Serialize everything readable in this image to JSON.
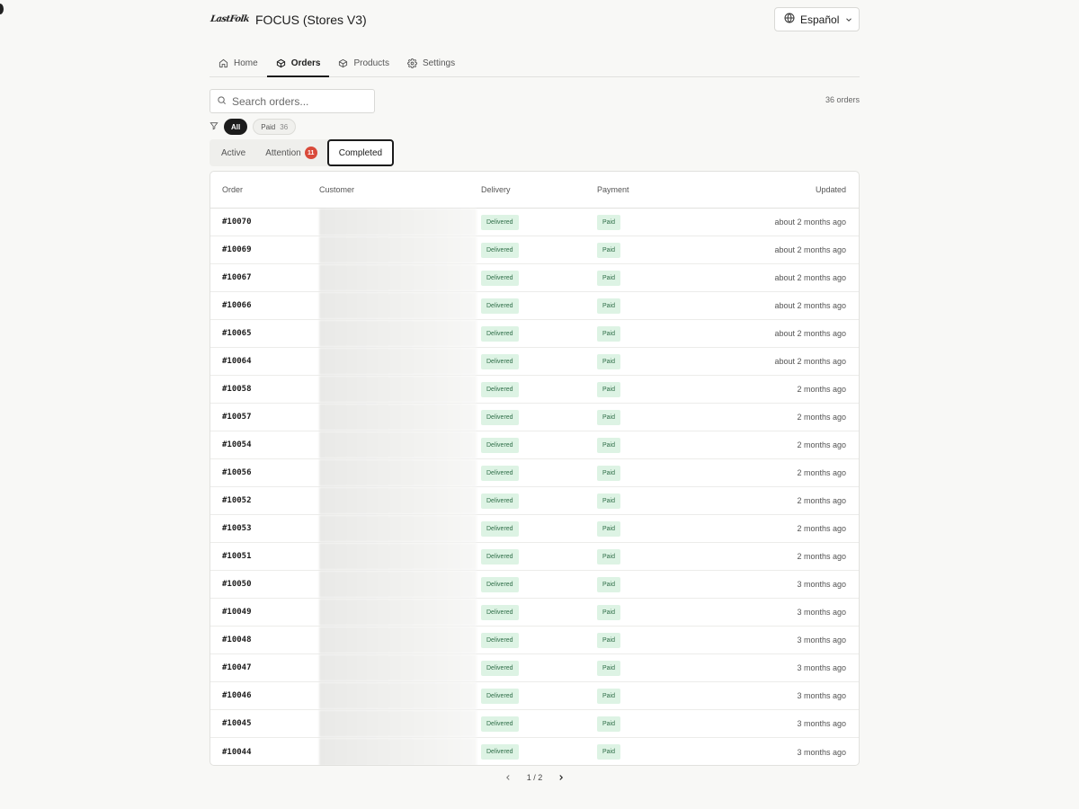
{
  "header": {
    "logo_text": "LastFolk",
    "app_title": "FOCUS (Stores V3)",
    "language": "Español"
  },
  "nav": {
    "tabs": [
      {
        "label": "Home",
        "icon": "home-icon",
        "active": false
      },
      {
        "label": "Orders",
        "icon": "box-icon",
        "active": true
      },
      {
        "label": "Products",
        "icon": "package-icon",
        "active": false
      },
      {
        "label": "Settings",
        "icon": "gear-icon",
        "active": false
      }
    ]
  },
  "search": {
    "placeholder": "Search orders...",
    "value": ""
  },
  "order_count": "36 orders",
  "filters": {
    "all_label": "All",
    "paid_label": "Paid",
    "paid_count": "36"
  },
  "status_tabs": {
    "active": "Active",
    "attention": "Attention",
    "attention_count": "11",
    "completed": "Completed"
  },
  "table": {
    "headers": {
      "order": "Order",
      "customer": "Customer",
      "delivery": "Delivery",
      "payment": "Payment",
      "updated": "Updated"
    },
    "rows": [
      {
        "order": "#10070",
        "delivery": "Delivered",
        "payment": "Paid",
        "updated": "about 2 months ago"
      },
      {
        "order": "#10069",
        "delivery": "Delivered",
        "payment": "Paid",
        "updated": "about 2 months ago"
      },
      {
        "order": "#10067",
        "delivery": "Delivered",
        "payment": "Paid",
        "updated": "about 2 months ago"
      },
      {
        "order": "#10066",
        "delivery": "Delivered",
        "payment": "Paid",
        "updated": "about 2 months ago"
      },
      {
        "order": "#10065",
        "delivery": "Delivered",
        "payment": "Paid",
        "updated": "about 2 months ago"
      },
      {
        "order": "#10064",
        "delivery": "Delivered",
        "payment": "Paid",
        "updated": "about 2 months ago"
      },
      {
        "order": "#10058",
        "delivery": "Delivered",
        "payment": "Paid",
        "updated": "2 months ago"
      },
      {
        "order": "#10057",
        "delivery": "Delivered",
        "payment": "Paid",
        "updated": "2 months ago"
      },
      {
        "order": "#10054",
        "delivery": "Delivered",
        "payment": "Paid",
        "updated": "2 months ago"
      },
      {
        "order": "#10056",
        "delivery": "Delivered",
        "payment": "Paid",
        "updated": "2 months ago"
      },
      {
        "order": "#10052",
        "delivery": "Delivered",
        "payment": "Paid",
        "updated": "2 months ago"
      },
      {
        "order": "#10053",
        "delivery": "Delivered",
        "payment": "Paid",
        "updated": "2 months ago"
      },
      {
        "order": "#10051",
        "delivery": "Delivered",
        "payment": "Paid",
        "updated": "2 months ago"
      },
      {
        "order": "#10050",
        "delivery": "Delivered",
        "payment": "Paid",
        "updated": "3 months ago"
      },
      {
        "order": "#10049",
        "delivery": "Delivered",
        "payment": "Paid",
        "updated": "3 months ago"
      },
      {
        "order": "#10048",
        "delivery": "Delivered",
        "payment": "Paid",
        "updated": "3 months ago"
      },
      {
        "order": "#10047",
        "delivery": "Delivered",
        "payment": "Paid",
        "updated": "3 months ago"
      },
      {
        "order": "#10046",
        "delivery": "Delivered",
        "payment": "Paid",
        "updated": "3 months ago"
      },
      {
        "order": "#10045",
        "delivery": "Delivered",
        "payment": "Paid",
        "updated": "3 months ago"
      },
      {
        "order": "#10044",
        "delivery": "Delivered",
        "payment": "Paid",
        "updated": "3 months ago"
      }
    ]
  },
  "pagination": {
    "label": "1 / 2"
  },
  "colors": {
    "accent": "#1c1c1c",
    "badge": "#d94a3a",
    "tag_bg": "#ddf3e4",
    "tag_text": "#2f6e48"
  }
}
